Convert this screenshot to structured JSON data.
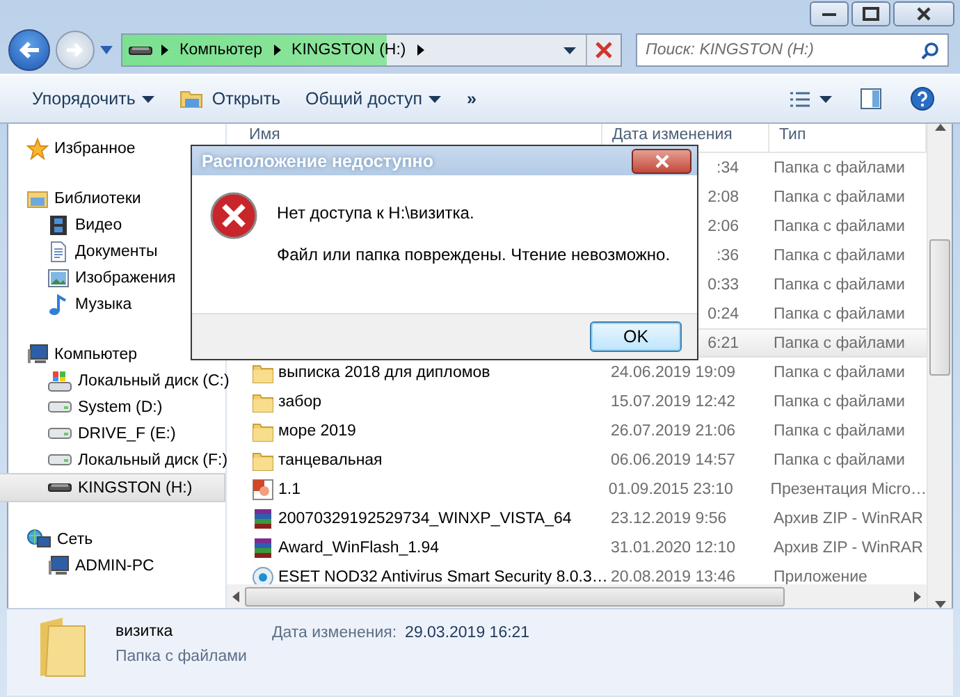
{
  "navigation": {
    "breadcrumb": [
      "Компьютер",
      "KINGSTON (H:)"
    ],
    "search": {
      "placeholder": "Поиск: KINGSTON (H:)"
    }
  },
  "toolbar": {
    "buttons": [
      {
        "label": "Упорядочить",
        "kind": "menu"
      },
      {
        "label": "Открыть",
        "kind": "open"
      },
      {
        "label": "Общий доступ",
        "kind": "menu"
      },
      {
        "label": "»",
        "kind": "more"
      }
    ]
  },
  "sidebar": {
    "groups": [
      {
        "label": "Избранное",
        "kind": "star",
        "selected": false
      },
      {
        "label": "Библиотеки",
        "kind": "library",
        "selected": false,
        "children": [
          {
            "label": "Видео",
            "kind": "video",
            "selected": false
          },
          {
            "label": "Документы",
            "kind": "document",
            "selected": false
          },
          {
            "label": "Изображения",
            "kind": "image",
            "selected": false
          },
          {
            "label": "Музыка",
            "kind": "music",
            "selected": false
          }
        ]
      },
      {
        "label": "Компьютер",
        "kind": "computer",
        "selected": false,
        "children": [
          {
            "label": "Локальный диск (C:)",
            "kind": "system-drive",
            "selected": false
          },
          {
            "label": "System (D:)",
            "kind": "drive",
            "selected": false
          },
          {
            "label": "DRIVE_F (E:)",
            "kind": "drive",
            "selected": false
          },
          {
            "label": "Локальный диск (F:)",
            "kind": "drive",
            "selected": false
          },
          {
            "label": "KINGSTON (H:)",
            "kind": "usb",
            "selected": true
          }
        ]
      },
      {
        "label": "Сеть",
        "kind": "network",
        "selected": false,
        "children": [
          {
            "label": "ADMIN-PC",
            "kind": "computer",
            "selected": false
          }
        ]
      }
    ]
  },
  "file_list": {
    "columns": [
      "Имя",
      "Дата изменения",
      "Тип"
    ],
    "rows": [
      {
        "kind": "hidden",
        "date": ":34",
        "type": "Папка с файлами",
        "selected": false
      },
      {
        "kind": "hidden",
        "date": "2:08",
        "type": "Папка с файлами",
        "selected": false
      },
      {
        "kind": "hidden",
        "date": "2:06",
        "type": "Папка с файлами",
        "selected": false
      },
      {
        "kind": "hidden",
        "date": ":36",
        "type": "Папка с файлами",
        "selected": false
      },
      {
        "kind": "hidden",
        "date": "0:33",
        "type": "Папка с файлами",
        "selected": false
      },
      {
        "kind": "hidden",
        "date": "0:24",
        "type": "Папка с файлами",
        "selected": false
      },
      {
        "kind": "hidden",
        "date": "6:21",
        "type": "Папка с файлами",
        "selected": true
      },
      {
        "kind": "folder",
        "name": "выписка 2018 для дипломов",
        "date": "24.06.2019 19:09",
        "type": "Папка с файлами",
        "selected": false
      },
      {
        "kind": "folder",
        "name": "забор",
        "date": "15.07.2019 12:42",
        "type": "Папка с файлами",
        "selected": false
      },
      {
        "kind": "folder",
        "name": "море 2019",
        "date": "26.07.2019 21:06",
        "type": "Папка с файлами",
        "selected": false
      },
      {
        "kind": "folder",
        "name": "танцевальная",
        "date": "06.06.2019 14:57",
        "type": "Папка с файлами",
        "selected": false
      },
      {
        "kind": "presentation",
        "name": "1.1",
        "date": "01.09.2015 23:10",
        "type": "Презентация Micro…",
        "selected": false
      },
      {
        "kind": "archive",
        "name": "20070329192529734_WINXP_VISTA_64",
        "date": "23.12.2019 9:56",
        "type": "Архив ZIP - WinRAR",
        "selected": false
      },
      {
        "kind": "archive",
        "name": "Award_WinFlash_1.94",
        "date": "31.01.2020 12:10",
        "type": "Архив ZIP - WinRAR",
        "selected": false
      },
      {
        "kind": "app",
        "name": "ESET NOD32 Antivirus  Smart Security 8.0.3…",
        "date": "20.08.2019 13:46",
        "type": "Приложение",
        "selected": false
      }
    ]
  },
  "details": {
    "name": "визитка",
    "type": "Папка с файлами",
    "date_label": "Дата изменения:",
    "date": "29.03.2019 16:21"
  },
  "dialog": {
    "title": "Расположение недоступно",
    "message": "Нет доступа к H:\\визитка.",
    "detail": "Файл или папка повреждены. Чтение невозможно.",
    "buttons": [
      "OK"
    ]
  }
}
